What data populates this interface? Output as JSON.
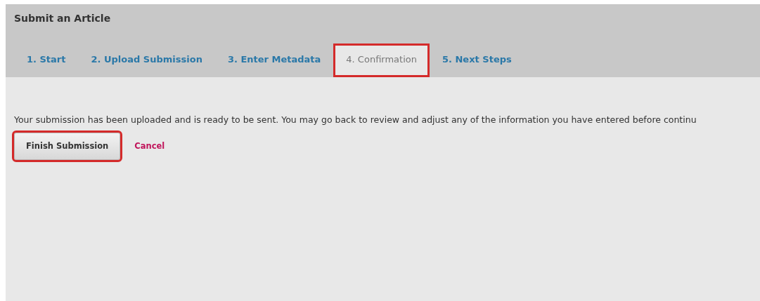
{
  "page": {
    "title": "Submit an Article"
  },
  "tabs": [
    {
      "label": "1. Start",
      "selected": false,
      "highlighted": false
    },
    {
      "label": "2. Upload Submission",
      "selected": false,
      "highlighted": false
    },
    {
      "label": "3. Enter Metadata",
      "selected": false,
      "highlighted": false
    },
    {
      "label": "4. Confirmation",
      "selected": true,
      "highlighted": true
    },
    {
      "label": "5. Next Steps",
      "selected": false,
      "highlighted": false
    }
  ],
  "message": "Your submission has been uploaded and is ready to be sent. You may go back to review and adjust any of the information you have entered before continu",
  "finish_button": {
    "label": "Finish Submission",
    "highlighted": true
  },
  "cancel_link": "Cancel"
}
